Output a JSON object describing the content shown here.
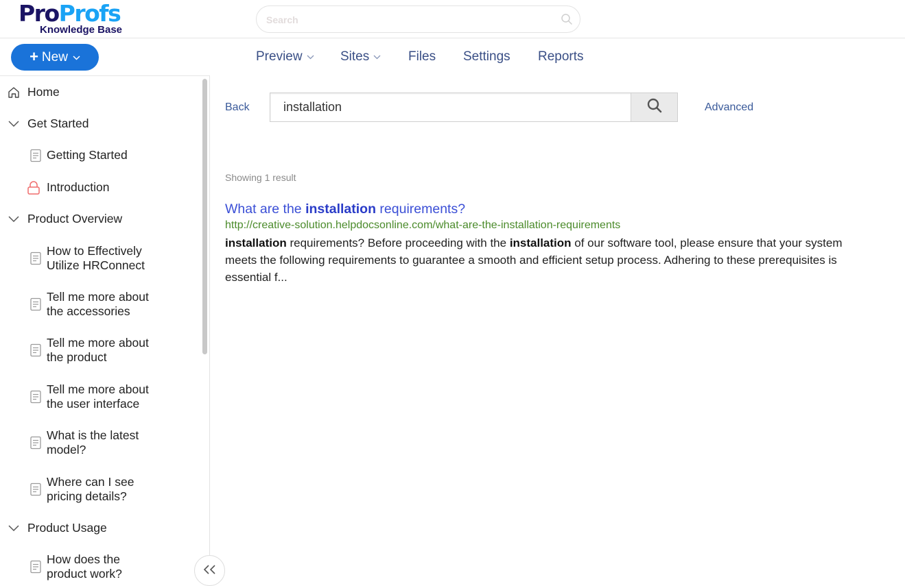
{
  "brand": {
    "logo_part1": "Pro",
    "logo_part2": "Profs",
    "logo_sub": "Knowledge Base",
    "color_dark": "#1b1464",
    "color_light": "#1aa3f5"
  },
  "top_search": {
    "placeholder": "Search",
    "value": ""
  },
  "new_button": {
    "plus": "+",
    "label": "New",
    "chevron": "⌄",
    "color": "#1a73d9"
  },
  "nav": {
    "items": [
      {
        "label": "Preview",
        "caret": "⌄"
      },
      {
        "label": "Sites",
        "caret": "⌄"
      },
      {
        "label": "Files"
      },
      {
        "label": "Settings"
      },
      {
        "label": "Reports"
      }
    ]
  },
  "sidebar": {
    "items": [
      {
        "label": "Home",
        "icon": "home-icon",
        "type": "link"
      },
      {
        "label": "Get Started",
        "icon": "chevron-down-icon",
        "type": "section"
      },
      {
        "label": "Getting Started",
        "icon": "document-icon",
        "type": "article"
      },
      {
        "label": "Introduction",
        "icon": "lock-icon",
        "type": "article"
      },
      {
        "label": "Product Overview",
        "icon": "chevron-down-icon",
        "type": "section"
      },
      {
        "label_line1": "How to Effectively",
        "label_line2": "Utilize HRConnect",
        "icon": "document-icon",
        "type": "article"
      },
      {
        "label_line1": "Tell me more about",
        "label_line2": "the accessories",
        "icon": "document-icon",
        "type": "article"
      },
      {
        "label_line1": "Tell me more about",
        "label_line2": "the product",
        "icon": "document-icon",
        "type": "article"
      },
      {
        "label_line1": "Tell me more about",
        "label_line2": "the user interface",
        "icon": "document-icon",
        "type": "article"
      },
      {
        "label_line1": "What is the latest",
        "label_line2": "model?",
        "icon": "document-icon",
        "type": "article"
      },
      {
        "label_line1": "Where can I see",
        "label_line2": "pricing details?",
        "icon": "document-icon",
        "type": "article"
      },
      {
        "label": "Product Usage",
        "icon": "chevron-down-icon",
        "type": "section"
      },
      {
        "label_line1": "How does the",
        "label_line2": "product work?",
        "icon": "document-icon",
        "type": "article"
      }
    ],
    "collapse_label": "<<"
  },
  "search_page": {
    "back_label": "Back",
    "query": "installation",
    "advanced_label": "Advanced",
    "result_count_text": "Showing 1 result",
    "results": [
      {
        "title_pre": "What are the ",
        "title_bold": "installation",
        "title_post": " requirements?",
        "url": "http://creative-solution.helpdocsonline.com/what-are-the-installation-requirements",
        "snippet_b1": "installation",
        "snippet_t1": " requirements? Before proceeding with the ",
        "snippet_b2": "installation",
        "snippet_t2": " of our software tool, please ensure that your system meets the following requirements to guarantee a smooth and efficient setup process. Adhering to these prerequisites is essential f..."
      }
    ]
  }
}
